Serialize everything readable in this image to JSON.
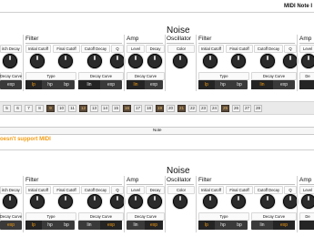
{
  "top": {
    "title": "MIDI Note I"
  },
  "panel1": {
    "noise": "Noise",
    "pitch": {
      "label_partial": "itch Decay",
      "curve_partial": "Decay Curve",
      "opts": [
        "exp"
      ]
    },
    "filter": {
      "title": "Filter",
      "labels": [
        "Initial Cutoff",
        "Final Cutoff",
        "Cutoff Decay",
        "Q"
      ],
      "type_label": "Type",
      "type_opts": [
        "lp",
        "hp",
        "bp"
      ],
      "curve_label": "Decay Curve",
      "curve_opts": [
        "lin",
        "exp"
      ]
    },
    "amp": {
      "title": "Amp",
      "labels": [
        "Level",
        "Decay"
      ],
      "curve_label": "Decay Curve",
      "curve_opts": [
        "lin",
        "exp"
      ]
    },
    "osc": {
      "title": "Oscillator",
      "color": "Color"
    },
    "filter2": {
      "title": "Filter",
      "labels": [
        "Initial Cutoff",
        "Final Cutoff",
        "Cutoff Decay",
        "Q"
      ],
      "type_label": "Type",
      "type_opts": [
        "lp",
        "hp",
        "bp"
      ],
      "curve_label": "Decay Curve",
      "curve_opts": [
        "lin",
        "exp"
      ]
    },
    "amp2": {
      "title": "Amp",
      "labels": [
        "Level"
      ],
      "curve_partial": "De"
    }
  },
  "steps": [
    "5",
    "6",
    "7",
    "8",
    "9",
    "10",
    "11",
    "12",
    "13",
    "14",
    "15",
    "16",
    "17",
    "18",
    "19",
    "20",
    "21",
    "22",
    "23",
    "24",
    "25",
    "26",
    "27",
    "28"
  ],
  "note": "Note",
  "warning": "oesn't support MIDI",
  "panel2": {
    "noise": "Noise",
    "pitch": {
      "label_partial": "itch Decay",
      "curve_partial": "Decay Curve",
      "opts": [
        "exp"
      ]
    },
    "filter": {
      "title": "Filter",
      "labels": [
        "Initial Cutoff",
        "Final Cutoff",
        "Cutoff Decay",
        "Q"
      ],
      "type_label": "Type",
      "type_opts": [
        "lp",
        "hp",
        "bp"
      ],
      "curve_label": "Decay Curve",
      "curve_opts": [
        "lin",
        "exp"
      ]
    },
    "amp": {
      "title": "Amp",
      "labels": [
        "Level",
        "Decay"
      ],
      "curve_label": "Decay Curve",
      "curve_opts": [
        "lin",
        "exp"
      ]
    },
    "osc": {
      "title": "Oscillator",
      "color": "Color"
    },
    "filter2": {
      "title": "Filter",
      "labels": [
        "Initial Cutoff",
        "Final Cutoff",
        "Cutoff Decay",
        "Q"
      ],
      "type_label": "Type",
      "type_opts": [
        "lp",
        "hp",
        "bp"
      ],
      "curve_label": "Decay Curve",
      "curve_opts": [
        "lin",
        "exp"
      ]
    },
    "amp2": {
      "title": "Amp",
      "labels": [
        "Level"
      ],
      "curve_partial": "De"
    }
  },
  "colors": {
    "accent": "#f39c12",
    "knob": "#2b2b2b",
    "segment_bg": "#3a3a3a"
  }
}
